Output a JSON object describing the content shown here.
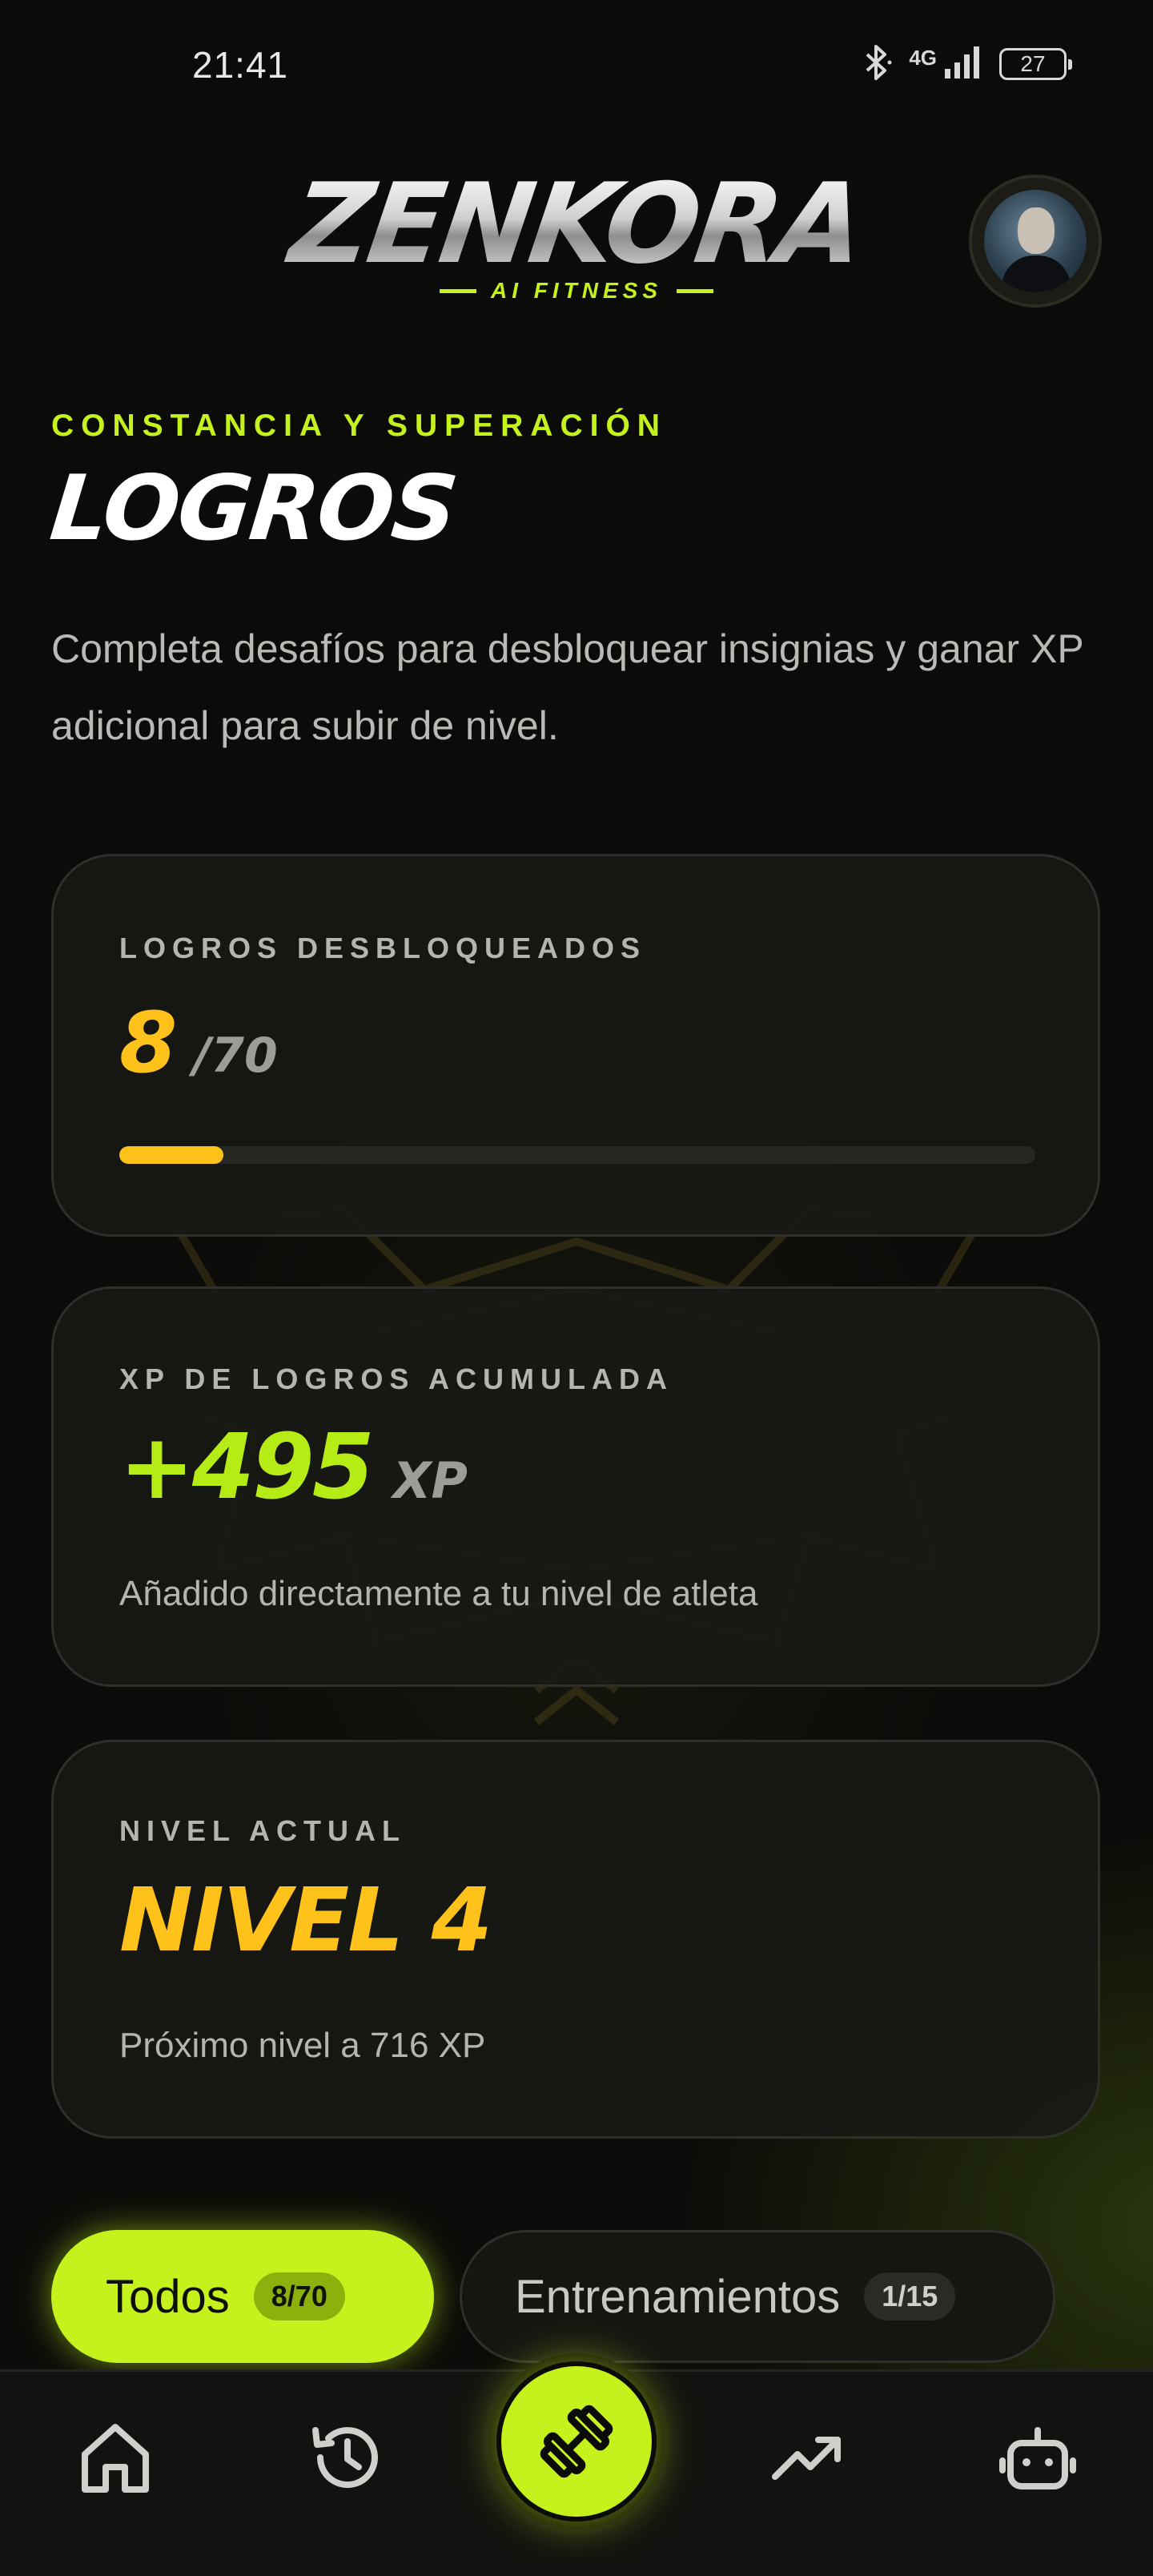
{
  "status_bar": {
    "time": "21:41",
    "network": "4G",
    "battery": "27"
  },
  "header": {
    "logo_main": "ZENKORA",
    "logo_sub": "AI FITNESS"
  },
  "intro": {
    "eyebrow": "CONSTANCIA Y SUPERACIÓN",
    "title": "LOGROS",
    "description": "Completa desafíos para desbloquear insignias y ganar XP adicional para subir de nivel."
  },
  "unlocked_card": {
    "label": "LOGROS DESBLOQUEADOS",
    "count": "8",
    "total": "/70",
    "progress_percent": 11.4
  },
  "xp_card": {
    "label": "XP DE LOGROS ACUMULADA",
    "amount": "+495",
    "unit": "XP",
    "note": "Añadido directamente a tu nivel de atleta"
  },
  "level_card": {
    "label": "NIVEL ACTUAL",
    "value": "NIVEL 4",
    "note": "Próximo nivel a 716 XP"
  },
  "filters": [
    {
      "label": "Todos",
      "badge": "8/70",
      "active": true
    },
    {
      "label": "Entrenamientos",
      "badge": "1/15",
      "active": false
    }
  ],
  "colors": {
    "accent_lime": "#c5f21d",
    "accent_gold": "#ffc21a",
    "background": "#0b0c09"
  },
  "nav": {
    "items": [
      "home-icon",
      "history-icon",
      "dumbbell-icon",
      "trending-icon",
      "robot-icon"
    ]
  }
}
